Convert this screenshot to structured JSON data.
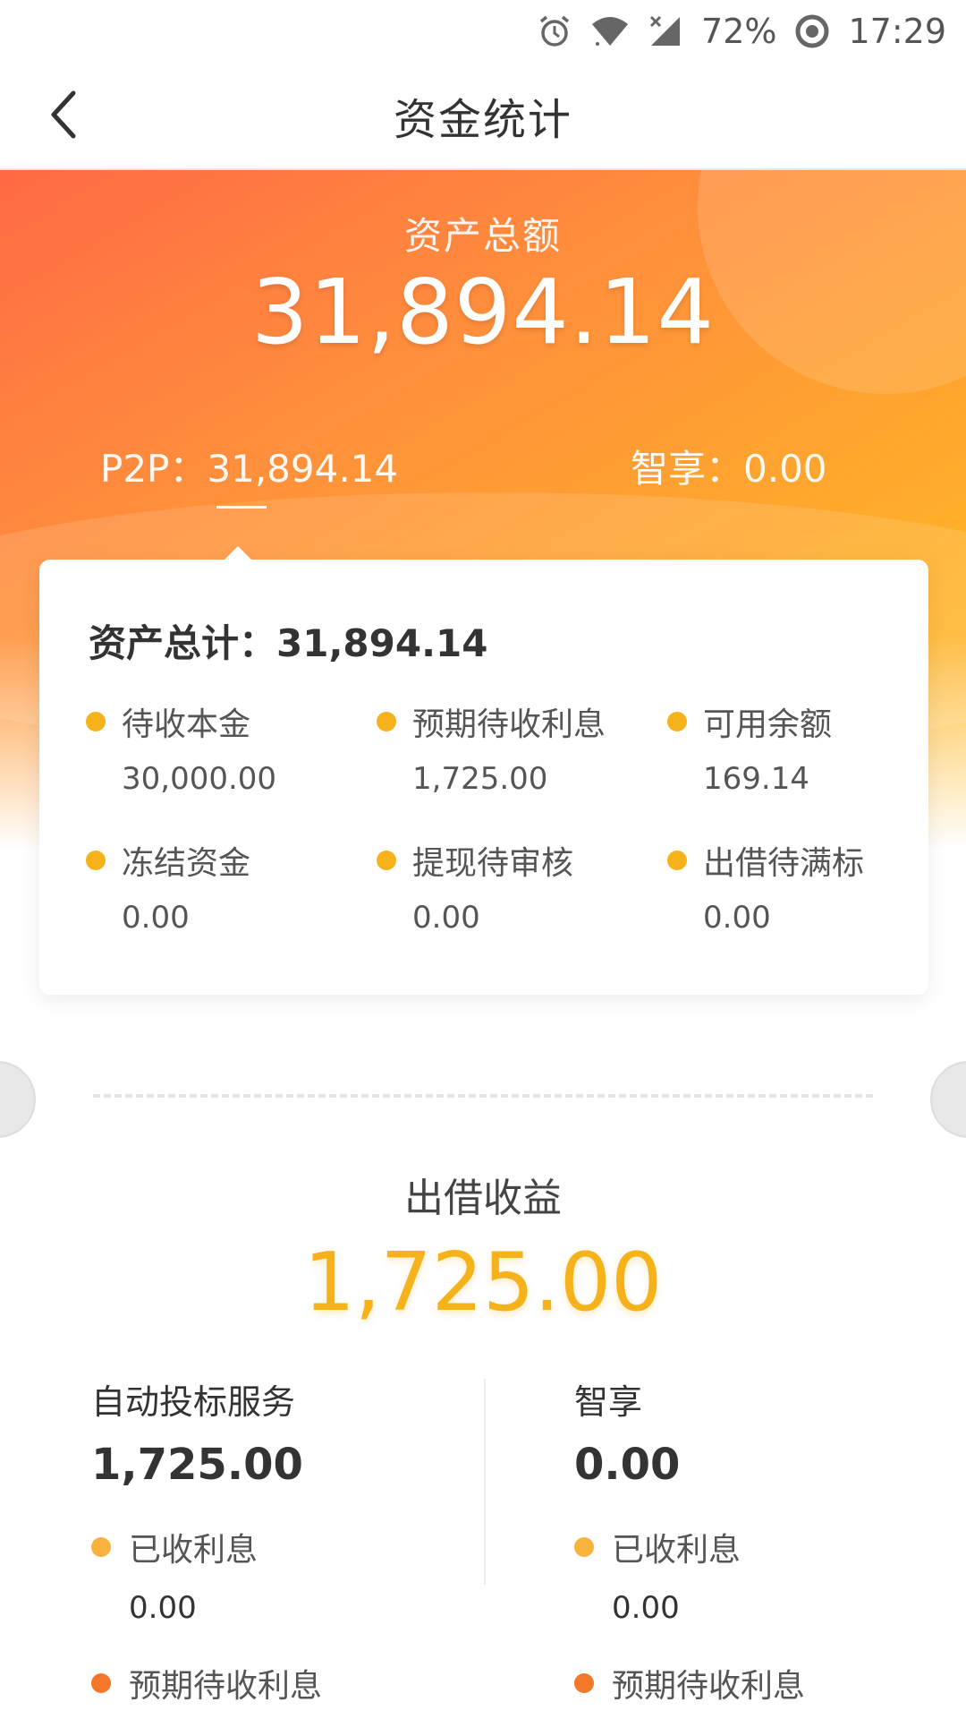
{
  "status_bar": {
    "battery": "72%",
    "time": "17:29",
    "icons": [
      "alarm-icon",
      "wifi-icon",
      "signal-icon",
      "sync-icon"
    ]
  },
  "nav": {
    "title": "资金统计",
    "back_icon": "chevron-left-icon"
  },
  "hero": {
    "label": "资产总额",
    "total": "31,894.14",
    "tabs": [
      {
        "label": "P2P：31,894.14"
      },
      {
        "label": "智享：0.00"
      }
    ]
  },
  "card": {
    "total_label": "资产总计：31,894.14",
    "stats": [
      {
        "label": "待收本金",
        "value": "30,000.00"
      },
      {
        "label": "预期待收利息",
        "value": "1,725.00"
      },
      {
        "label": "可用余额",
        "value": "169.14"
      },
      {
        "label": "冻结资金",
        "value": "0.00"
      },
      {
        "label": "提现待审核",
        "value": "0.00"
      },
      {
        "label": "出借待满标",
        "value": "0.00"
      }
    ]
  },
  "earnings": {
    "label": "出借收益",
    "value": "1,725.00",
    "columns": [
      {
        "title": "自动投标服务",
        "value": "1,725.00",
        "items": [
          {
            "label": "已收利息",
            "value": "0.00"
          },
          {
            "label": "预期待收利息"
          }
        ]
      },
      {
        "title": "智享",
        "value": "0.00",
        "items": [
          {
            "label": "已收利息",
            "value": "0.00"
          },
          {
            "label": "预期待收利息"
          }
        ]
      }
    ]
  },
  "colors": {
    "accent": "#f6b21b",
    "orange_dot": "#f5782a",
    "hero_start": "#ff6a45",
    "hero_end": "#ffc23a"
  }
}
